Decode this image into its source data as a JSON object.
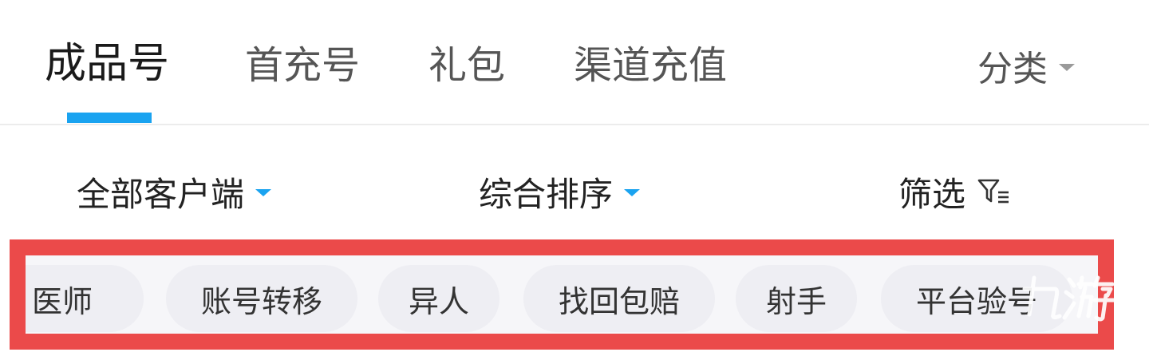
{
  "tabs": [
    {
      "label": "成品号",
      "active": true
    },
    {
      "label": "首充号",
      "active": false
    },
    {
      "label": "礼包",
      "active": false
    },
    {
      "label": "渠道充值",
      "active": false
    }
  ],
  "category": {
    "label": "分类",
    "icon": "caret-down-icon"
  },
  "filters": {
    "client": {
      "label": "全部客户端",
      "icon": "caret-down-icon"
    },
    "sort": {
      "label": "综合排序",
      "icon": "caret-down-icon"
    },
    "screen": {
      "label": "筛选",
      "icon": "funnel-icon"
    }
  },
  "tags": [
    "医师",
    "账号转移",
    "异人",
    "找回包赔",
    "射手",
    "平台验号"
  ],
  "watermark": {
    "text": "九游"
  },
  "colors": {
    "accent": "#1aa3f0",
    "highlight_border": "#eb4a4a",
    "chip_bg": "#eeeef3",
    "text_active": "#1a1a1a",
    "text_muted": "#555555"
  }
}
